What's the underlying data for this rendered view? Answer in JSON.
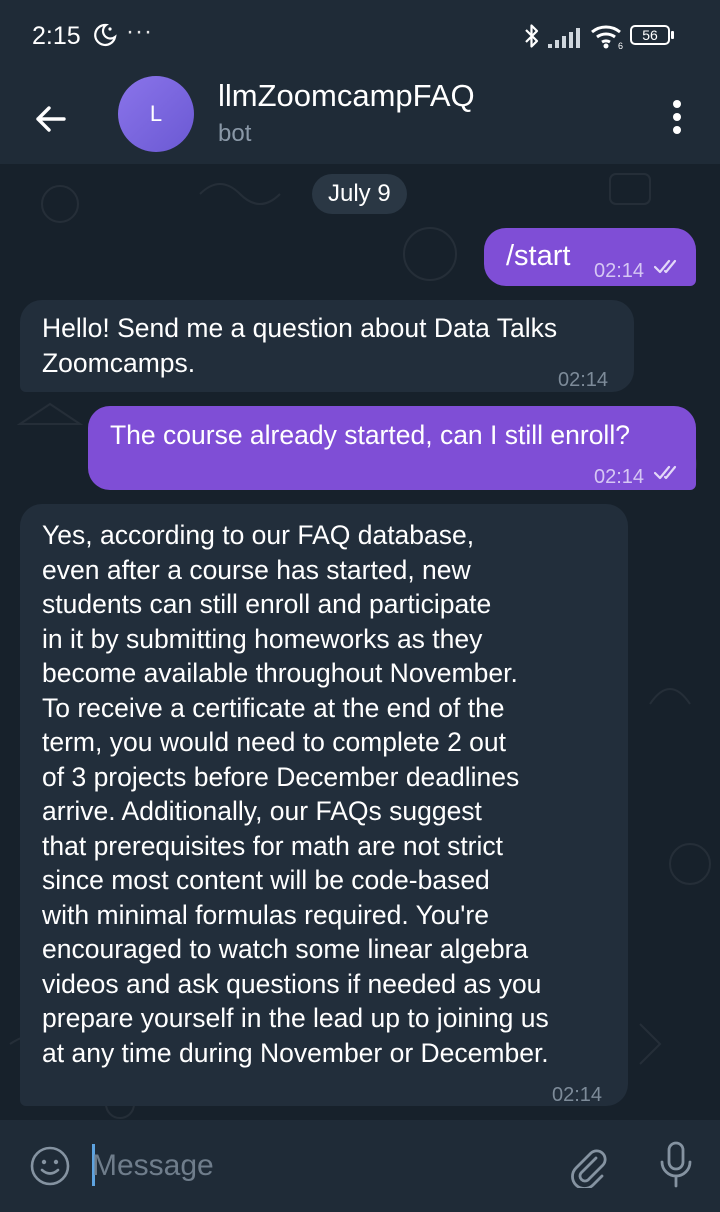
{
  "status_bar": {
    "time": "2:15",
    "more": "···",
    "battery": "56",
    "wifi_badge": "6"
  },
  "header": {
    "avatar_initial": "L",
    "title": "llmZoomcampFAQ",
    "subtitle": "bot"
  },
  "chat": {
    "date_label": "July 9",
    "messages": [
      {
        "direction": "outgoing",
        "text": "/start",
        "time": "02:14",
        "status": "read"
      },
      {
        "direction": "incoming",
        "lines": [
          "Hello! Send me a question about Data Talks",
          "Zoomcamps."
        ],
        "time": "02:14"
      },
      {
        "direction": "outgoing",
        "text": "The course already started, can I still enroll?",
        "time": "02:14",
        "status": "read"
      },
      {
        "direction": "incoming",
        "lines": [
          "Yes, according to our FAQ database,",
          "even after a course has started, new",
          "students can still enroll and participate",
          "in it by submitting homeworks as they",
          "become available throughout November.",
          "To receive a certificate at the end of the",
          "term, you would need to complete 2 out",
          "of 3 projects before December deadlines",
          "arrive. Additionally, our FAQs suggest",
          "that prerequisites for math are not strict",
          "since most content will be code-based",
          "with minimal formulas required. You're",
          "encouraged to watch some linear algebra",
          "videos and ask questions if needed as you",
          "prepare yourself in the lead up to joining us",
          "at any time during November or December."
        ],
        "time": "02:14"
      }
    ]
  },
  "composer": {
    "placeholder": "Message"
  },
  "colors": {
    "outgoing_bubble": "#7f4ed6",
    "incoming_bubble": "#222e3b",
    "background": "#17212b",
    "bars": "#1f2b37"
  },
  "icons": [
    "back-arrow-icon",
    "more-vertical-icon",
    "emoji-icon",
    "attach-icon",
    "microphone-icon",
    "double-check-icon",
    "bluetooth-icon",
    "signal-icon",
    "wifi-icon",
    "battery-icon",
    "moon-icon"
  ]
}
